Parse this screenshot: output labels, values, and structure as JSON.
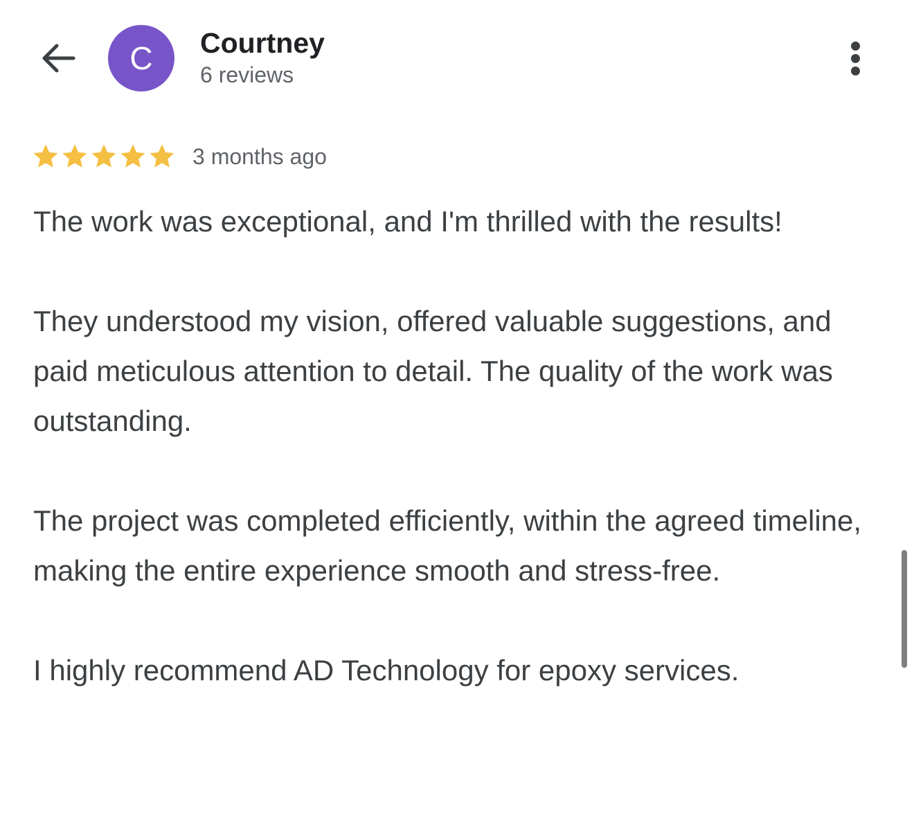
{
  "header": {
    "back_icon": "arrow-left-icon",
    "avatar_letter": "C",
    "avatar_color": "#7755c9",
    "reviewer_name": "Courtney",
    "review_count": "6 reviews",
    "more_icon": "more-vertical-icon"
  },
  "review": {
    "rating": 5,
    "rating_max": 5,
    "star_color": "#f4bf42",
    "date": "3 months ago",
    "paragraphs": [
      "The work was exceptional, and I'm thrilled with the results!",
      "They understood my vision, offered valuable suggestions, and paid meticulous attention to detail. The quality of the work was outstanding.",
      "The project was completed efficiently, within the agreed timeline, making the entire experience smooth and stress-free.",
      "I highly recommend AD Technology for epoxy services."
    ]
  }
}
